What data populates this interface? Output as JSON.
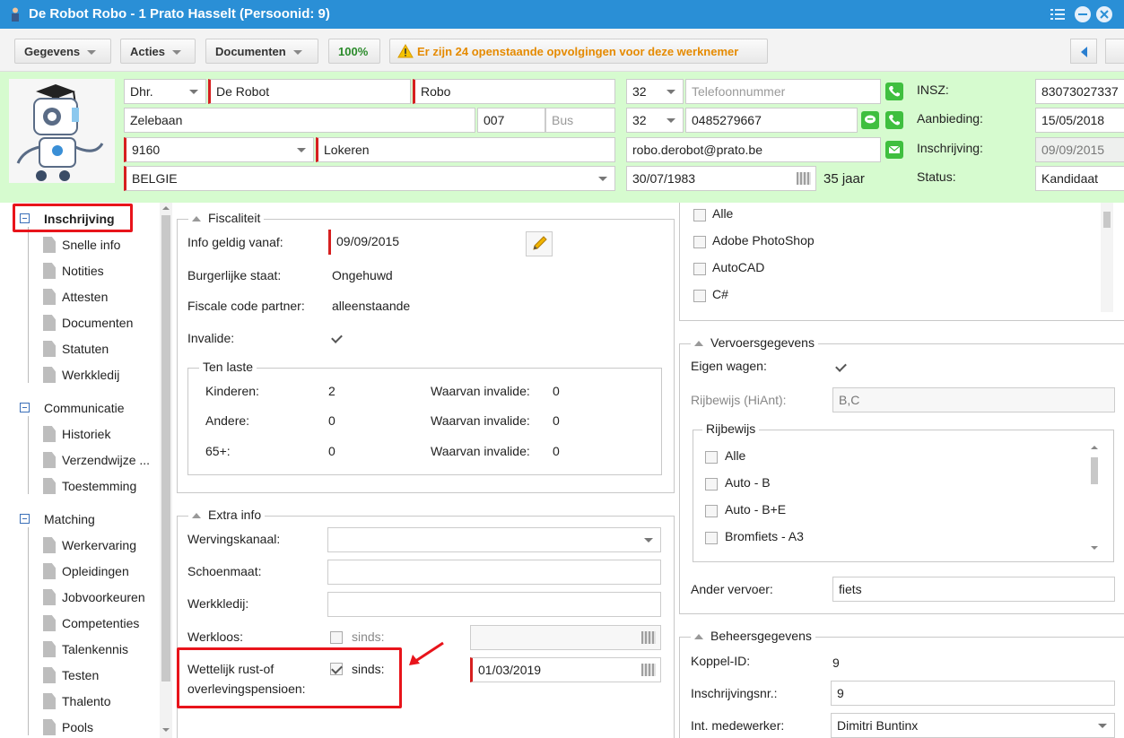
{
  "window": {
    "title": "De Robot Robo - 1 Prato Hasselt (Persoonid: 9)"
  },
  "toolbar": {
    "gegevens": "Gegevens",
    "acties": "Acties",
    "documenten": "Documenten",
    "percent": "100%",
    "warning": "Er zijn 24 openstaande opvolgingen voor deze werknemer"
  },
  "header": {
    "title_select": "Dhr.",
    "last_name": "De Robot",
    "first_name": "Robo",
    "street": "Zelebaan",
    "number": "007",
    "bus_placeholder": "Bus",
    "postcode": "9160",
    "city": "Lokeren",
    "country": "BELGIE",
    "phone_prefix_1": "32",
    "phone_placeholder": "Telefoonnummer",
    "phone_prefix_2": "32",
    "mobile": "0485279667",
    "email": "robo.derobot@prato.be",
    "birthdate": "30/07/1983",
    "age": "35 jaar",
    "insz_label": "INSZ:",
    "insz_value": "83073027337",
    "aanbieding_label": "Aanbieding:",
    "aanbieding_value": "15/05/2018",
    "inschrijving_label": "Inschrijving:",
    "inschrijving_value": "09/09/2015",
    "status_label": "Status:",
    "status_value": "Kandidaat"
  },
  "nav": {
    "groups": [
      {
        "label": "Inschrijving",
        "items": [
          "Snelle info",
          "Notities",
          "Attesten",
          "Documenten",
          "Statuten",
          "Werkkledij"
        ]
      },
      {
        "label": "Communicatie",
        "items": [
          "Historiek",
          "Verzendwijze ...",
          "Toestemming"
        ]
      },
      {
        "label": "Matching",
        "items": [
          "Werkervaring",
          "Opleidingen",
          "Jobvoorkeuren",
          "Competenties",
          "Talenkennis",
          "Testen",
          "Thalento",
          "Pools"
        ]
      }
    ]
  },
  "fiscaliteit": {
    "legend": "Fiscaliteit",
    "info_label": "Info geldig vanaf:",
    "info_value": "09/09/2015",
    "burger_label": "Burgerlijke staat:",
    "burger_value": "Ongehuwd",
    "fiscale_label": "Fiscale code partner:",
    "fiscale_value": "alleenstaande",
    "invalide_label": "Invalide:",
    "invalide_checked": true,
    "ten_laste": {
      "legend": "Ten laste",
      "rows": [
        {
          "label": "Kinderen:",
          "value": "2",
          "inv_label": "Waarvan invalide:",
          "inv_value": "0"
        },
        {
          "label": "Andere:",
          "value": "0",
          "inv_label": "Waarvan invalide:",
          "inv_value": "0"
        },
        {
          "label": "65+:",
          "value": "0",
          "inv_label": "Waarvan invalide:",
          "inv_value": "0"
        }
      ]
    }
  },
  "extra": {
    "legend": "Extra info",
    "wervingskanaal_label": "Wervingskanaal:",
    "schoenmaat_label": "Schoenmaat:",
    "werkkledij_label": "Werkkledij:",
    "werkloos_label": "Werkloos:",
    "sinds_label": "sinds:",
    "pensioen_label_1": "Wettelijk rust-of",
    "pensioen_label_2": "overlevingspensioen:",
    "pensioen_sinds": "sinds:",
    "pensioen_date": "01/03/2019"
  },
  "software": {
    "items": [
      "Alle",
      "Adobe PhotoShop",
      "AutoCAD",
      "C#"
    ]
  },
  "vervoer": {
    "legend": "Vervoersgegevens",
    "eigen_label": "Eigen wagen:",
    "rijbewijs_hiant_label": "Rijbewijs (HiAnt):",
    "rijbewijs_hiant_value": "B,C",
    "rijbewijs_legend": "Rijbewijs",
    "rijbewijs_items": [
      "Alle",
      "Auto - B",
      "Auto - B+E",
      "Bromfiets - A3"
    ],
    "ander_label": "Ander vervoer:",
    "ander_value": "fiets"
  },
  "beheer": {
    "legend": "Beheersgegevens",
    "koppel_label": "Koppel-ID:",
    "koppel_value": "9",
    "inschr_label": "Inschrijvingsnr.:",
    "inschr_value": "9",
    "medew_label": "Int. medewerker:",
    "medew_value": "Dimitri Buntinx"
  },
  "colors": {
    "titlebar": "#2a8fd6",
    "header_bg": "#d6fbcf",
    "highlight": "#e8141b",
    "required": "#d62020"
  }
}
